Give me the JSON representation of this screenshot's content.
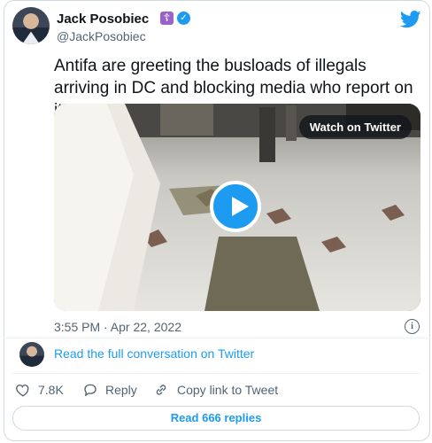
{
  "author": {
    "name": "Jack Posobiec",
    "handle": "@JackPosobiec",
    "badge_glyph": "☦",
    "verified_glyph": "✓"
  },
  "tweet": {
    "text": "Antifa are greeting the busloads of illegals arriving in DC and blocking media who report on it",
    "timestamp": "3:55 PM · Apr 22, 2022"
  },
  "media": {
    "watch_label": "Watch on Twitter"
  },
  "info_glyph": "i",
  "conversation_link": "Read the full conversation on Twitter",
  "actions": {
    "likes": "7.8K",
    "reply": "Reply",
    "copy_link": "Copy link to Tweet"
  },
  "replies_button": "Read 666 replies",
  "colors": {
    "accent": "#1d9bf0",
    "secondary_text": "#536471",
    "border": "#cfd9de"
  },
  "icons": [
    "twitter-logo-icon",
    "verified-icon",
    "play-icon",
    "info-icon",
    "heart-icon",
    "reply-icon",
    "link-icon"
  ]
}
